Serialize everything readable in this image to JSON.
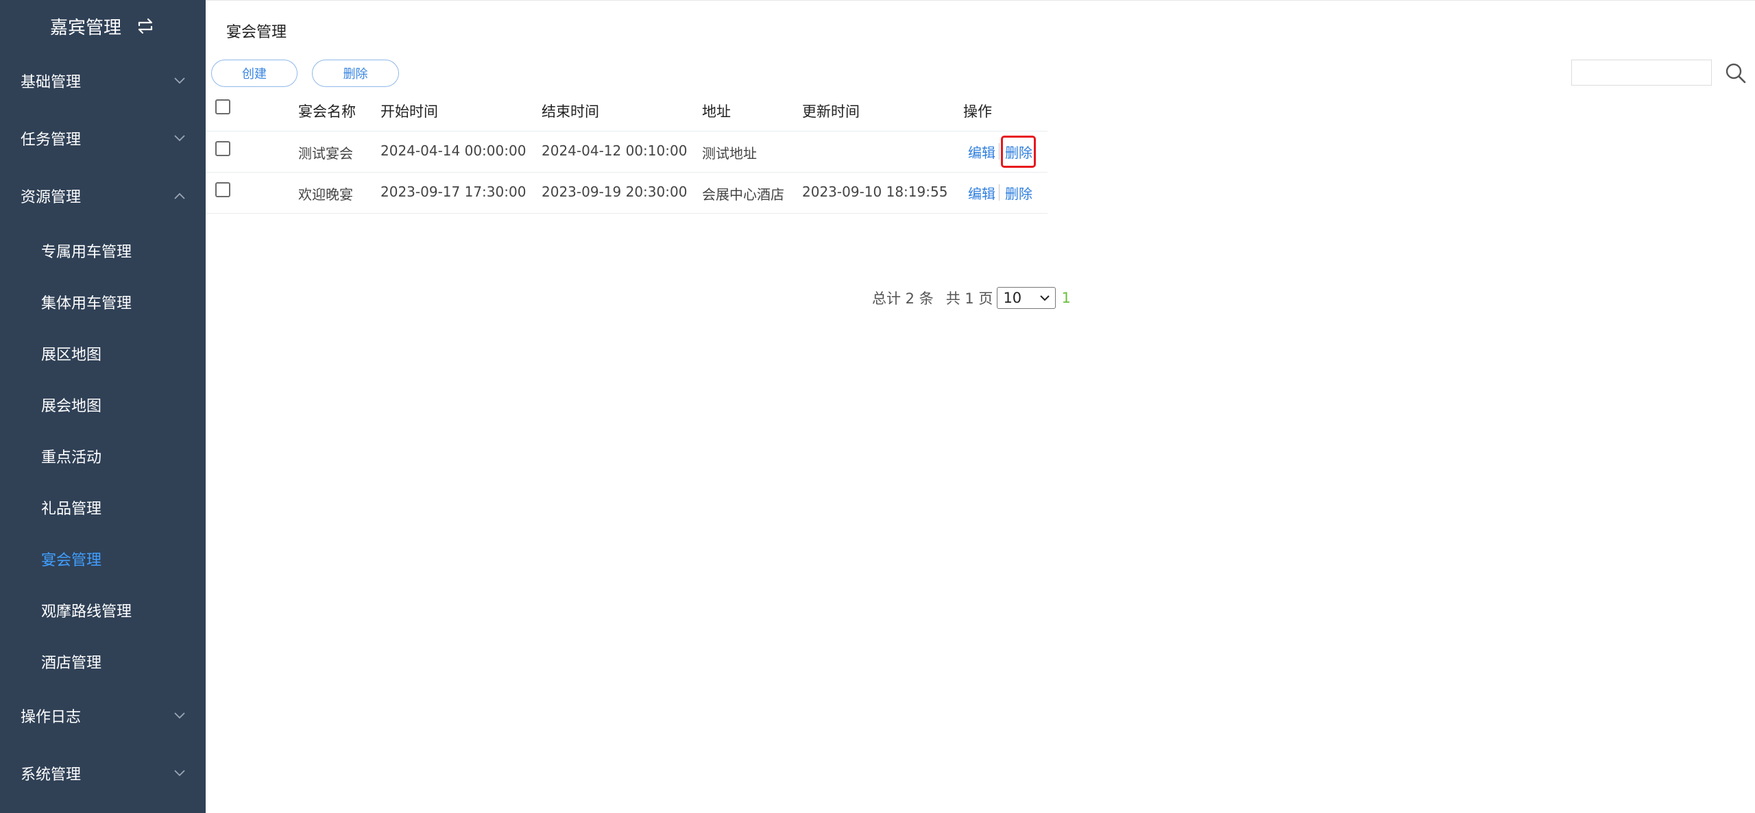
{
  "sidebar": {
    "brand": "嘉宾管理",
    "swap_icon": "swap-arrows-icon",
    "groups": {
      "basic": "基础管理",
      "task": "任务管理",
      "resource": "资源管理",
      "log": "操作日志",
      "system": "系统管理"
    },
    "resource_items": [
      "专属用车管理",
      "集体用车管理",
      "展区地图",
      "展会地图",
      "重点活动",
      "礼品管理",
      "宴会管理",
      "观摩路线管理",
      "酒店管理"
    ],
    "active_item": "宴会管理",
    "active_color": "#409eff",
    "background": "#304156"
  },
  "main": {
    "title": "宴会管理",
    "toolbar": {
      "create_label": "创建",
      "delete_label": "删除"
    },
    "search": {
      "value": "",
      "placeholder": ""
    },
    "table": {
      "headers": [
        "宴会名称",
        "开始时间",
        "结束时间",
        "地址",
        "更新时间",
        "操作"
      ],
      "rows": [
        {
          "name": "测试宴会",
          "start": "2024-04-14 00:00:00",
          "end": "2024-04-12 00:10:00",
          "address": "测试地址",
          "updated": "",
          "edit": "编辑",
          "delete": "删除",
          "delete_highlighted": true
        },
        {
          "name": "欢迎晚宴",
          "start": "2023-09-17 17:30:00",
          "end": "2023-09-19 20:30:00",
          "address": "会展中心酒店",
          "updated": "2023-09-10 18:19:55",
          "edit": "编辑",
          "delete": "删除",
          "delete_highlighted": false
        }
      ]
    },
    "pagination": {
      "total_text": "总计 2 条",
      "pages_text": "共 1 页",
      "page_size": "10",
      "current_page": "1"
    },
    "colors": {
      "link": "#2f7fde",
      "highlight": "#e8171c",
      "current_page": "#6bbf3b"
    }
  }
}
